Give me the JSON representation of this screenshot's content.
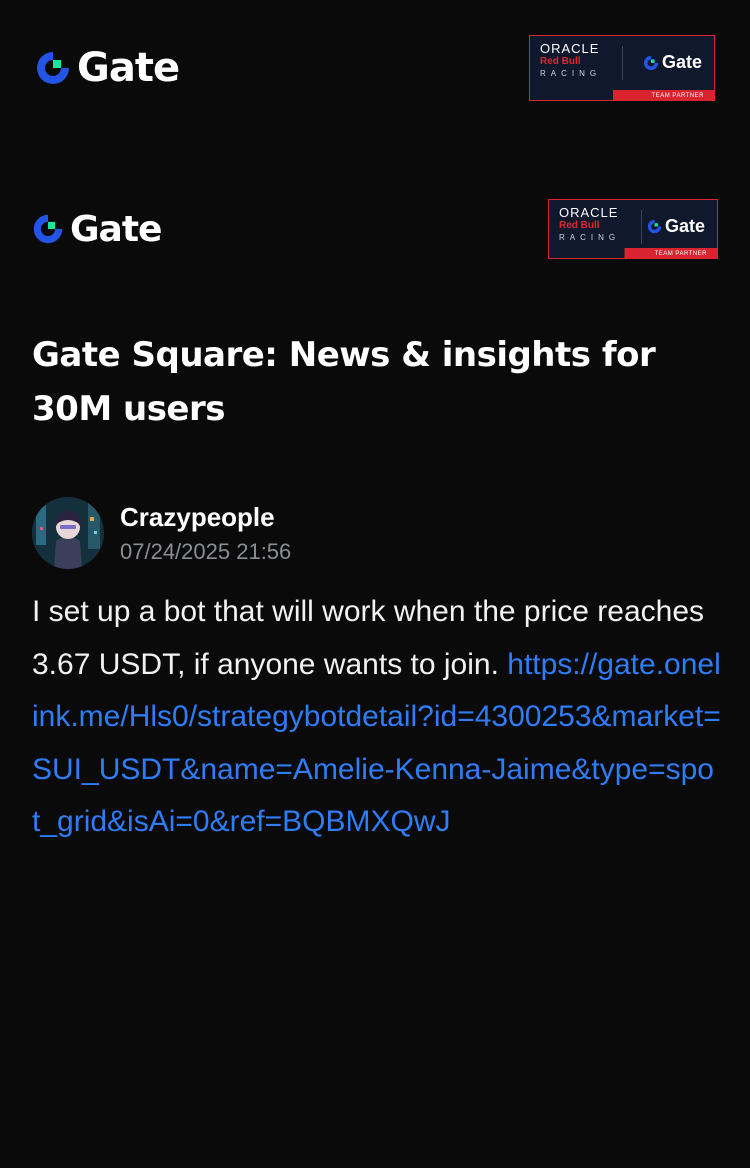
{
  "header_primary": {
    "logo_text": "Gate",
    "partner_badge": {
      "line1": "ORACLE",
      "line2": "Red Bull",
      "line3": "RACING",
      "brand": "Gate",
      "caption": "TEAM PARTNER"
    }
  },
  "header_secondary": {
    "logo_text": "Gate",
    "partner_badge": {
      "line1": "ORACLE",
      "line2": "Red Bull",
      "line3": "RACING",
      "brand": "Gate",
      "caption": "TEAM PARTNER"
    }
  },
  "headline": "Gate Square: News & insights for 30M users",
  "post": {
    "author": "Crazypeople",
    "timestamp": "07/24/2025 21:56",
    "text": "I set up a bot that will work when the price reaches 3.67 USDT, if anyone wants to join.",
    "link": "https://gate.onelink.me/Hls0/strategybotdetail?id=4300253&market=SUI_USDT&name=Amelie-Kenna-Jaime&type=spot_grid&isAi=0&ref=BQBMXQwJ"
  },
  "colors": {
    "background": "#0a0a0b",
    "link": "#2e7cf6",
    "brand_blue": "#2354e6",
    "brand_green": "#17e6a1",
    "partner_red": "#d9232f",
    "muted_text": "#8a8d93"
  },
  "icons": {
    "logo": "gate-logo-icon",
    "avatar": "user-avatar"
  }
}
